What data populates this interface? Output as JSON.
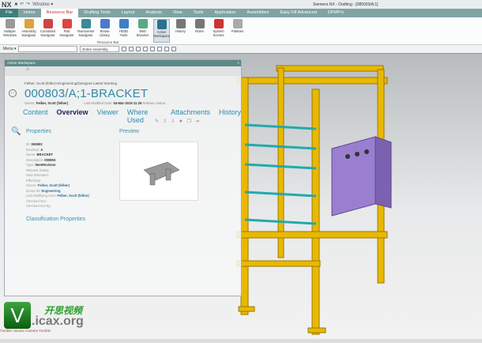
{
  "titlebar": {
    "app": "NX",
    "window_menu": "Window ▾",
    "title": "Siemens NX - Drafting - [085003/A;1]"
  },
  "tabs": [
    "File",
    "Home",
    "Resource Bar",
    "Drafting Tools",
    "Layout",
    "Analysis",
    "View",
    "Tools",
    "Application",
    "Assemblies",
    "Easy Fill Advanced",
    "DFMPro"
  ],
  "ribbon": {
    "buttons": [
      "Multiple Windows",
      "Assembly Navigator",
      "Constraint Navigator",
      "Part Navigator",
      "Teamcenter Navigator",
      "Reuse Library",
      "HD3D Tools",
      "Web Browser",
      "Active Workspace",
      "History",
      "Roles",
      "System Scenes",
      "Palettes"
    ],
    "group_label": "Resource Bar"
  },
  "toolbar": {
    "menu": "Menu ▾",
    "filter": "",
    "scope": "Entire Assembly"
  },
  "workspace": {
    "header": "Active Workspace",
    "close": "×",
    "breadcrumb": "Felber, Scott (felber)-Engineering/Designer-Latest Working",
    "title": "000803/A;1-BRACKET",
    "owner_label": "Owner:",
    "owner": "Felber, Scott (felber)",
    "modified_label": "Last Modified Date:",
    "modified": "04-Mar-2015 11:26",
    "release_label": "Release Status:",
    "tabs": [
      "Content",
      "Overview",
      "Viewer",
      "Where Used",
      "Attachments",
      "History"
    ],
    "properties_title": "Properties",
    "preview_title": "Preview",
    "properties": [
      {
        "k": "ID:",
        "v": "000803"
      },
      {
        "k": "Revision:",
        "v": "A"
      },
      {
        "k": "Name:",
        "v": "BRACKET"
      },
      {
        "k": "Description:",
        "v": "000803"
      },
      {
        "k": "Type:",
        "v": "ItemRevision"
      },
      {
        "k": "Release Status:",
        "v": ""
      },
      {
        "k": "Date Released:",
        "v": ""
      },
      {
        "k": "Effectivity:",
        "v": ""
      },
      {
        "k": "Owner:",
        "v": "Felber, Scott (felber)"
      },
      {
        "k": "Group ID:",
        "v": "Engineering"
      },
      {
        "k": "Last Modifying User:",
        "v": "Felber, Scott (felber)"
      },
      {
        "k": "Checked-Out:",
        "v": ""
      },
      {
        "k": "Checked-Out By:",
        "v": ""
      }
    ],
    "classification_title": "Classification Properties"
  },
  "status": "Tumble: Mouse Camera Tumble",
  "watermark": {
    "cn": "开思视频",
    "en": ".icax.org",
    "v": "V"
  },
  "colors": {
    "accent": "#2f8aa8",
    "frame": "#e6b800",
    "box": "#9a7fd0"
  }
}
